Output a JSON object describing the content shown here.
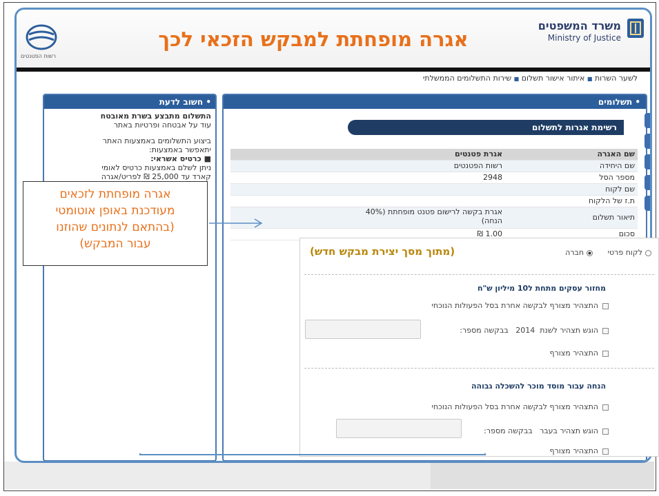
{
  "header": {
    "title": "אגרה מופחתת למבקש הזכאי לכך",
    "ministry_he": "משרד המשפטים",
    "ministry_en": "Ministry of Justice",
    "logo_caption": "רשות הפטנטים",
    "logo_icon": "patent-authority-logo",
    "emblem_icon": "state-emblem-icon"
  },
  "breadcrumb": {
    "items": [
      "לשער השרות",
      "איתור אישור תשלום",
      "שירות התשלומים הממשלתי"
    ],
    "separator": "■"
  },
  "sidebar": {
    "heading": "• חשוב לדעת",
    "lines": [
      "התשלום מתבצע בשרת מאובטח",
      "עוד על אבטחה ופרטיות באתר",
      "",
      "ביצוע התשלומים באמצעות האתר",
      "יתאפשר באמצעות:",
      "■ כרטיס אשראי:",
      "ניתן לשלם באמצעות כרטיס לאומי",
      "קארד עד 25,000 ₪ לפריט/אגרה"
    ]
  },
  "main": {
    "heading": "• תשלומים",
    "list_title": "רשימת אגרות לתשלום",
    "table": [
      {
        "label": "שם האגרה",
        "value": "אגרת פטנטים",
        "style": "head"
      },
      {
        "label": "שם היחידה",
        "value": "רשות הפטנטים",
        "style": "shaded"
      },
      {
        "label": "מספר הסל",
        "value": "2948",
        "style": "plain"
      },
      {
        "label": "שם לקוח",
        "value": "",
        "style": "shaded"
      },
      {
        "label": "ת.ז של הלקוח",
        "value": "",
        "style": "plain"
      },
      {
        "label": "תיאור תשלום",
        "value": "אגרת בקשה לרישום פטנט מופחתת (40% הנחה)",
        "style": "shaded"
      },
      {
        "label": "סכום",
        "value": "1.00 ₪",
        "style": "plain"
      }
    ]
  },
  "callout": {
    "text_lines": [
      "אגרה מופחתת לזכאים",
      "מעודכנת באופן אוטומטי",
      "(בהתאם לנתונים שהוזנו",
      "עבור המבקש)"
    ]
  },
  "overlay": {
    "title": "(מתוך מסך יצירת מבקש חדש)",
    "radio_private": "לקוח פרטי",
    "radio_company": "חברה",
    "radio_selected": "חברה",
    "section1": "מחזור עסקים מתחת ל10 מיליון ש\"ח",
    "s1_check1": "התצהיר מצורף לבקשה אחרת בסל הפעולות הנוכחי",
    "s1_check2_prefix": "הוגש תצהיר לשנת",
    "s1_check2_year": "2014",
    "s1_check2_suffix": "בבקשה מספר:",
    "s1_check3": "התצהיר מצורף",
    "section2": "הנחה עבור מוסד מוכר להשכלה גבוהה",
    "s2_check1": "התצהיר מצורף לבקשה אחרת בסל הפעולות הנוכחי",
    "s2_check2_prefix": "הוגש תצהיר בעבר",
    "s2_check2_suffix": "בבקשה מספר:",
    "s2_check3": "התצהיר מצורף"
  },
  "colors": {
    "accent_orange": "#e8701a",
    "frame_blue": "#5b8fc4",
    "header_navy": "#2c5e9c",
    "overlay_title": "#b8860b"
  }
}
